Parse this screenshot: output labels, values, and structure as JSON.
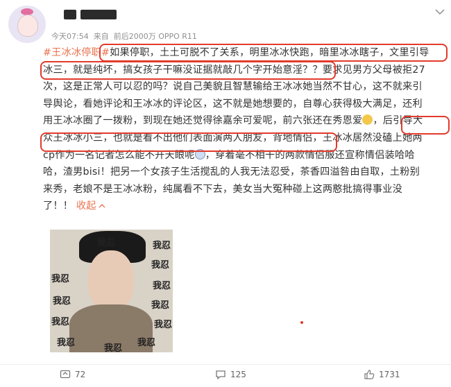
{
  "post": {
    "time": "今天07:54",
    "source_label": "来自",
    "device": "前后2000万 OPPO R11",
    "lines": [
      [
        {
          "t": "#王冰冰停职#",
          "c": "hashtag"
        },
        {
          "t": "如果停职，土土可脱不了关系，明里冰冰快跑，暗里冰冰瞎子，文里引导"
        }
      ],
      [
        {
          "t": "冰三，就是纯坏，搞女孩子干嘛没证据就敲几个字开始意淫？？要求见男方父母被拒27"
        }
      ],
      [
        {
          "t": "次，这是正常人可以忍的吗？说自己美貌且智慧输给王冰冰她当然不甘心，这不就来引"
        }
      ],
      [
        {
          "t": "导舆论，看她评论和王冰冰的评论区，这不就是她想要的，自尊心获得极大满足，还利"
        }
      ],
      [
        {
          "t": "用王冰冰圈了一拨粉，到现在她还觉得徐嘉余可爱呢，前六张还在秀恩爱"
        },
        {
          "t": "[emoji]",
          "c": "emoji"
        },
        {
          "t": "，后引导大"
        }
      ],
      [
        {
          "t": "众王冰冰小三，也就是看不出他们表面演两人朋友，背地情侣，王冰冰居然没磕上她两"
        }
      ],
      [
        {
          "t": "cp作为一名记者怎么能不开天眼呢"
        },
        {
          "t": "[emoji2]",
          "c": "emoji2"
        },
        {
          "t": "，穿着毫不相干的两款情侣服还宣称情侣装哈哈"
        }
      ],
      [
        {
          "t": "哈，渣男bisi！把另一个女孩子生活搅乱的人我无法忍受，茶香四溢咎由自取，土粉别"
        }
      ],
      [
        {
          "t": "来秀，老娘不是王冰冰粉，纯属看不下去，美女当大冤种碰上这两憨批搞得事业没"
        }
      ],
      [
        {
          "t": "了！！ "
        },
        {
          "t": "收起",
          "c": "collapse"
        },
        {
          "t": "[chevron]",
          "c": "chevron"
        }
      ]
    ]
  },
  "meme": {
    "stamps": [
      "我忍",
      "我忍",
      "我忍",
      "我忍",
      "我忍",
      "我忍",
      "我忍",
      "我忍",
      "我忍",
      "我忍",
      "我忍",
      "我忍"
    ]
  },
  "footer": {
    "repost_count": "72",
    "comment_count": "125",
    "like_count": "1731"
  },
  "colors": {
    "accent": "#eb7350",
    "highlight_box": "#e23a2b",
    "meta": "#8f8f8f"
  }
}
